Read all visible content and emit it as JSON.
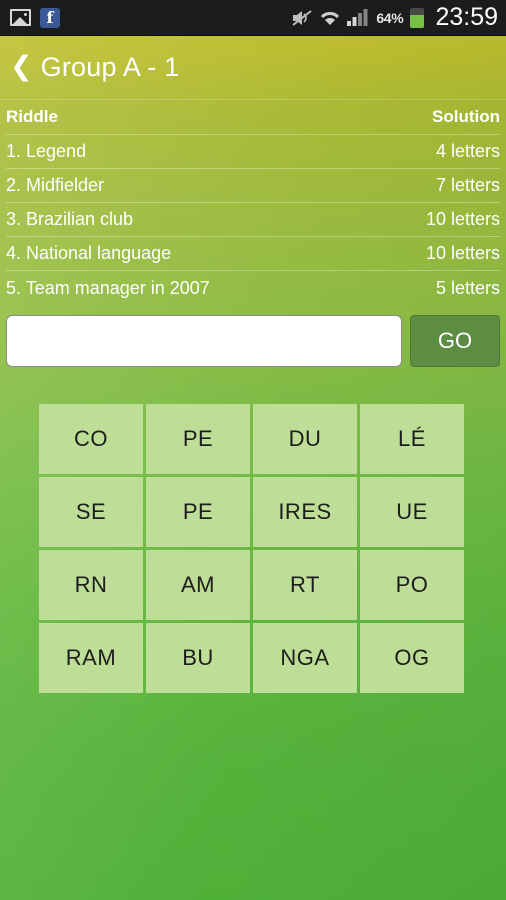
{
  "statusbar": {
    "icons_left": [
      {
        "name": "gallery-icon",
        "label": ""
      },
      {
        "name": "facebook-icon",
        "label": "f"
      }
    ],
    "mute_icon": "mute-icon",
    "wifi_icon": "wifi-icon",
    "signal_icon": "signal-bars-icon",
    "battery_percent": "64%",
    "battery_icon": "battery-icon",
    "time": "23:59"
  },
  "titlebar": {
    "back_chevron": "❮",
    "title": "Group A - 1"
  },
  "table": {
    "header": {
      "riddle": "Riddle",
      "solution": "Solution"
    },
    "rows": [
      {
        "riddle": "1. Legend",
        "solution": "4 letters"
      },
      {
        "riddle": "2. Midfielder",
        "solution": "7 letters"
      },
      {
        "riddle": "3. Brazilian club",
        "solution": "10 letters"
      },
      {
        "riddle": "4. National language",
        "solution": "10 letters"
      },
      {
        "riddle": "5. Team manager in 2007",
        "solution": "5 letters"
      }
    ]
  },
  "answer": {
    "value": "",
    "placeholder": "",
    "go_label": "GO"
  },
  "tiles": [
    "CO",
    "PE",
    "DU",
    "LÉ",
    "SE",
    "PE",
    "IRES",
    "UE",
    "RN",
    "AM",
    "RT",
    "PO",
    "RAM",
    "BU",
    "NGA",
    "OG"
  ],
  "colors": {
    "accent_top": "#c3bd2b",
    "accent_bottom": "#4fb038",
    "tile": "#bedd96",
    "go_button": "#5d8c43",
    "statusbar": "#1c1c1c",
    "battery_fill": "#76c043",
    "facebook_blue": "#3b5998"
  }
}
